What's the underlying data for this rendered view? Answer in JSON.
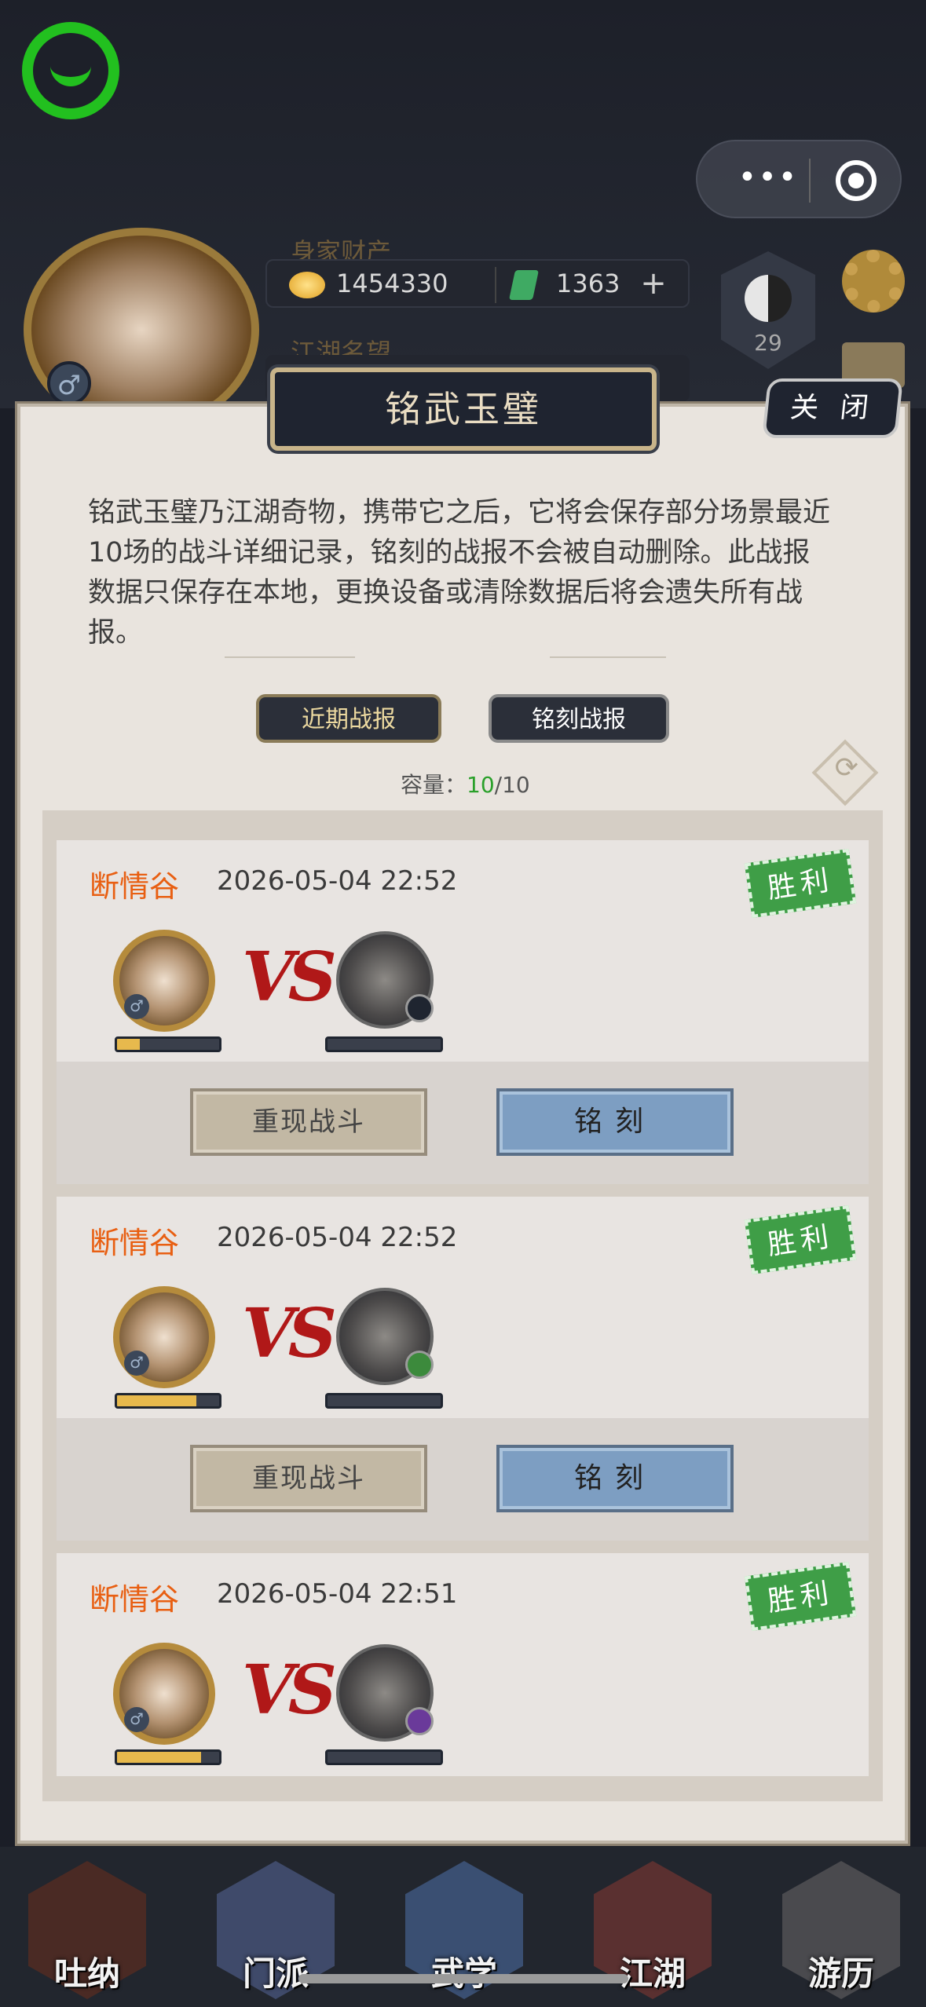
{
  "header": {
    "wealth_label": "身家财产",
    "fame_label": "江湖名望",
    "coins": "1454330",
    "jade": "1363",
    "plus": "+",
    "level": "29",
    "capsule_more": "•••"
  },
  "panel": {
    "title": "铭武玉璧",
    "close_label": "关 闭",
    "description": "铭武玉璧乃江湖奇物，携带它之后，它将会保存部分场景最近10场的战斗详细记录，铭刻的战报不会被自动删除。此战报数据只保存在本地，更换设备或清除数据后将会遗失所有战报。",
    "tabs": [
      {
        "label": "近期战报",
        "active": true
      },
      {
        "label": "铭刻战报",
        "active": false
      }
    ],
    "capacity_label": "容量：",
    "capacity_used": "10",
    "capacity_total": "/10"
  },
  "battles": [
    {
      "place": "断情谷",
      "time": "2026-05-04 22:52",
      "result": "胜利",
      "vs": "VS",
      "gender": "♂",
      "player_hp": 0.22,
      "replay_label": "重现战斗",
      "engrave_label": "铭刻"
    },
    {
      "place": "断情谷",
      "time": "2026-05-04 22:52",
      "result": "胜利",
      "vs": "VS",
      "gender": "♂",
      "player_hp": 0.78,
      "replay_label": "重现战斗",
      "engrave_label": "铭刻"
    },
    {
      "place": "断情谷",
      "time": "2026-05-04 22:51",
      "result": "胜利",
      "vs": "VS",
      "gender": "♂",
      "player_hp": 0.82
    }
  ],
  "nav": [
    {
      "label": "吐纳"
    },
    {
      "label": "门派"
    },
    {
      "label": "武学"
    },
    {
      "label": "江湖"
    },
    {
      "label": "游历"
    }
  ],
  "colors": {
    "accent_orange": "#e85f12",
    "win_green": "#3f9e47",
    "engrave_blue": "#7d9ec2"
  }
}
